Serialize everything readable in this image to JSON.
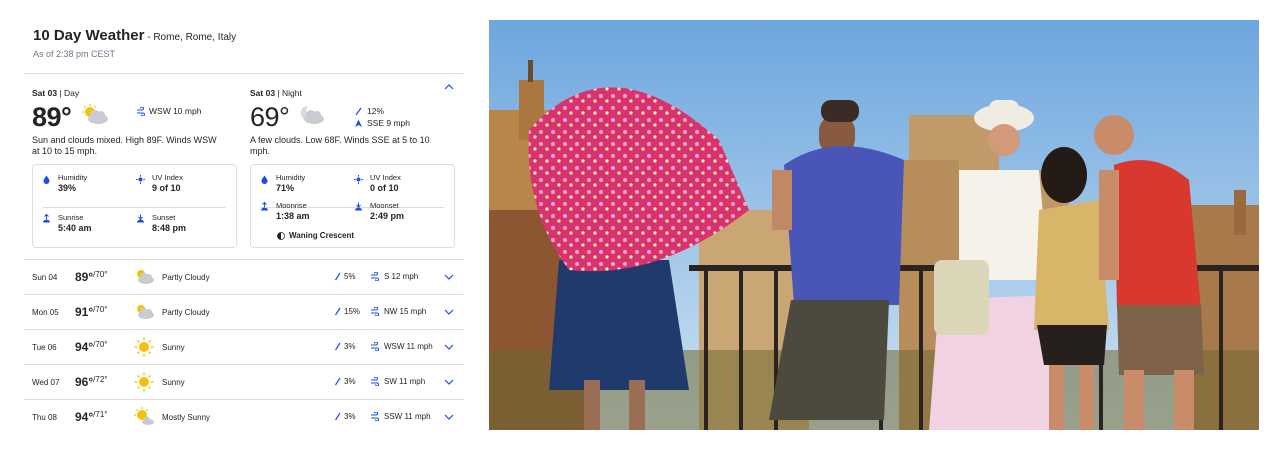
{
  "header": {
    "title": "10 Day Weather",
    "location": " - Rome, Rome, Italy",
    "as_of": "As of 2:38 pm CEST"
  },
  "today": {
    "day": {
      "label": "Sat 03",
      "period": " | Day",
      "temp": "89°",
      "wind": "WSW 10 mph",
      "narrative": "Sun and clouds mixed. High 89F. Winds WSW at 10 to 15 mph.",
      "icon": "partly-cloudy-icon",
      "details": {
        "humidity_label": "Humidity",
        "humidity": "39%",
        "uv_label": "UV Index",
        "uv": "9 of 10",
        "sunrise_label": "Sunrise",
        "sunrise": "5:40 am",
        "sunset_label": "Sunset",
        "sunset": "8:48 pm"
      }
    },
    "night": {
      "label": "Sat 03",
      "period": " | Night",
      "temp": "69°",
      "precip": "12%",
      "wind": "SSE 9 mph",
      "narrative": "A few clouds. Low 68F. Winds SSE at 5 to 10 mph.",
      "icon": "night-cloudy-icon",
      "details": {
        "humidity_label": "Humidity",
        "humidity": "71%",
        "uv_label": "UV Index",
        "uv": "0 of 10",
        "moonrise_label": "Moonrise",
        "moonrise": "1:38 am",
        "moonset_label": "Moonset",
        "moonset": "2:49 pm",
        "moon_phase": "Waning Crescent"
      }
    }
  },
  "forecast": [
    {
      "day": "Sun 04",
      "hi": "89°",
      "lo": "/70°",
      "cond": "Partly Cloudy",
      "icon": "partly-cloudy-icon",
      "rain": "5%",
      "wind": "S 12 mph"
    },
    {
      "day": "Mon 05",
      "hi": "91°",
      "lo": "/70°",
      "cond": "Partly Cloudy",
      "icon": "partly-cloudy-icon",
      "rain": "15%",
      "wind": "NW 15 mph"
    },
    {
      "day": "Tue 06",
      "hi": "94°",
      "lo": "/70°",
      "cond": "Sunny",
      "icon": "sun-icon",
      "rain": "3%",
      "wind": "WSW 11 mph"
    },
    {
      "day": "Wed 07",
      "hi": "96°",
      "lo": "/72°",
      "cond": "Sunny",
      "icon": "sun-icon",
      "rain": "3%",
      "wind": "SW 11 mph"
    },
    {
      "day": "Thu 08",
      "hi": "94°",
      "lo": "/71°",
      "cond": "Mostly Sunny",
      "icon": "mostly-sunny-icon",
      "rain": "3%",
      "wind": "SSW 11 mph"
    }
  ],
  "colors": {
    "accent_blue": "#1b4de4",
    "sun_yellow": "#f5c20b",
    "cloud_gray": "#c8ccd2",
    "umbrella_pink": "#d8326f",
    "shirt_red": "#d9382f",
    "shirt_blue": "#4a55b8"
  },
  "photo": {
    "scene": "tourists-with-umbrella-overlooking-roman-forum"
  }
}
